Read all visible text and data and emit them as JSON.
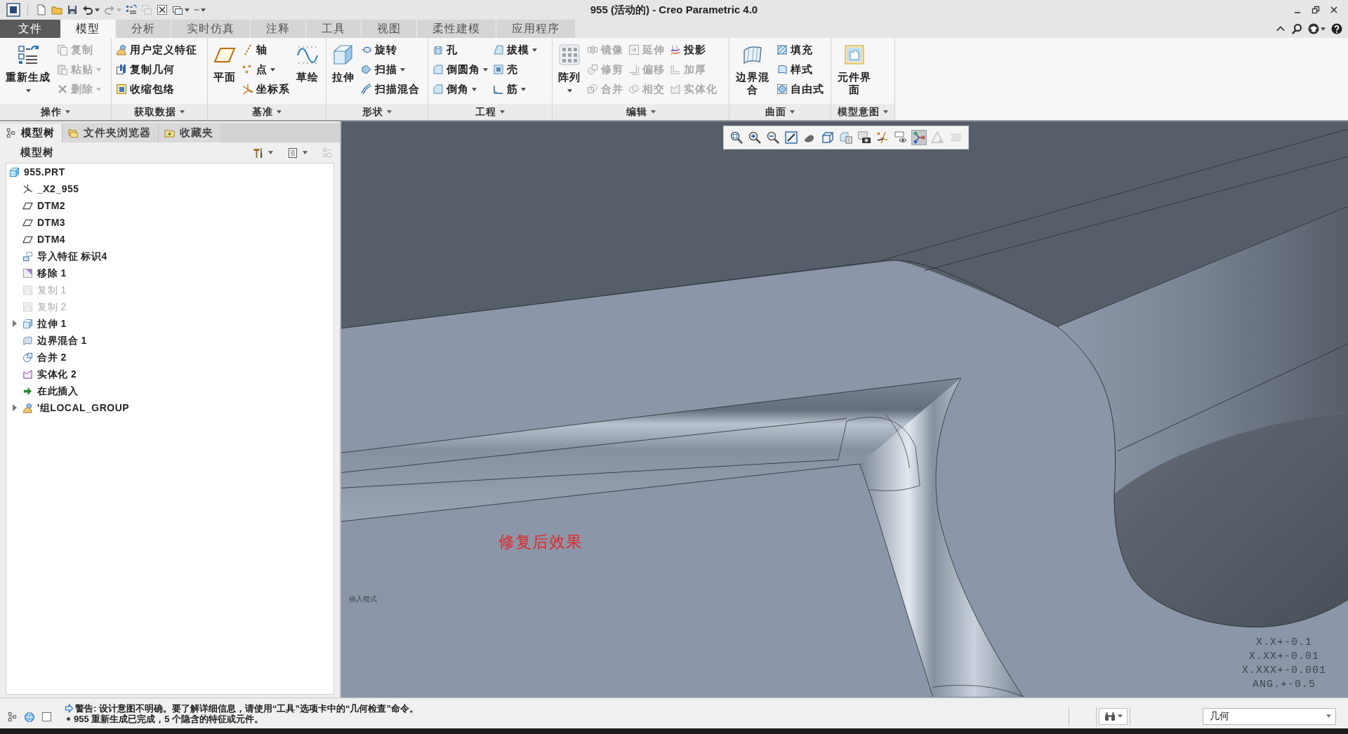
{
  "window": {
    "title": "955 (活动的) - Creo Parametric 4.0"
  },
  "quick_access": [
    {
      "disabled": false,
      "dropdown": false
    },
    {
      "disabled": false,
      "dropdown": false
    },
    {
      "disabled": false,
      "dropdown": false
    },
    {
      "disabled": false,
      "dropdown": true
    },
    {
      "disabled": true,
      "dropdown": true
    },
    {
      "disabled": false,
      "dropdown": false
    },
    {
      "disabled": true,
      "dropdown": false
    },
    {
      "disabled": false,
      "dropdown": false
    },
    {
      "disabled": false,
      "dropdown": true
    },
    {
      "disabled": false,
      "dropdown": true
    }
  ],
  "ribbon_tabs": [
    {
      "label": "文件",
      "kind": "menu",
      "selected": false
    },
    {
      "label": "模型",
      "kind": "tab",
      "selected": true
    },
    {
      "label": "分析",
      "kind": "tab",
      "selected": false
    },
    {
      "label": "实时仿真",
      "kind": "tab",
      "selected": false
    },
    {
      "label": "注释",
      "kind": "tab",
      "selected": false
    },
    {
      "label": "工具",
      "kind": "tab",
      "selected": false
    },
    {
      "label": "视图",
      "kind": "tab",
      "selected": false
    },
    {
      "label": "柔性建模",
      "kind": "tab",
      "selected": false
    },
    {
      "label": "应用程序",
      "kind": "tab",
      "selected": false
    }
  ],
  "ribbon": {
    "groups": [
      {
        "label": "操作",
        "dropdown": true,
        "columns": [
          [
            {
              "kind": "large",
              "label": "重新生成",
              "dropdown": true,
              "disabled": false
            }
          ],
          [
            {
              "kind": "small",
              "label": "复制",
              "dropdown": false,
              "disabled": true
            },
            {
              "kind": "small",
              "label": "粘贴",
              "dropdown": true,
              "disabled": true
            },
            {
              "kind": "small",
              "label": "删除",
              "dropdown": true,
              "disabled": true
            }
          ]
        ]
      },
      {
        "label": "获取数据",
        "dropdown": true,
        "columns": [
          [
            {
              "kind": "small",
              "label": "用户定义特征",
              "dropdown": false,
              "disabled": false
            },
            {
              "kind": "small",
              "label": "复制几何",
              "dropdown": false,
              "disabled": false
            },
            {
              "kind": "small",
              "label": "收缩包络",
              "dropdown": false,
              "disabled": false
            }
          ]
        ]
      },
      {
        "label": "基准",
        "dropdown": true,
        "columns": [
          [
            {
              "kind": "large",
              "label": "平面",
              "dropdown": false,
              "disabled": false
            }
          ],
          [
            {
              "kind": "small",
              "label": "轴",
              "dropdown": false,
              "disabled": false
            },
            {
              "kind": "small",
              "label": "点",
              "dropdown": true,
              "disabled": false
            },
            {
              "kind": "small",
              "label": "坐标系",
              "dropdown": false,
              "disabled": false
            }
          ],
          [
            {
              "kind": "large",
              "label": "草绘",
              "dropdown": false,
              "disabled": false
            }
          ]
        ]
      },
      {
        "label": "形状",
        "dropdown": true,
        "columns": [
          [
            {
              "kind": "large",
              "label": "拉伸",
              "dropdown": false,
              "disabled": false
            }
          ],
          [
            {
              "kind": "small",
              "label": "旋转",
              "dropdown": false,
              "disabled": false
            },
            {
              "kind": "small",
              "label": "扫描",
              "dropdown": true,
              "disabled": false
            },
            {
              "kind": "small",
              "label": "扫描混合",
              "dropdown": false,
              "disabled": false
            }
          ]
        ]
      },
      {
        "label": "工程",
        "dropdown": true,
        "columns": [
          [
            {
              "kind": "small",
              "label": "孔",
              "dropdown": false,
              "disabled": false
            },
            {
              "kind": "small",
              "label": "倒圆角",
              "dropdown": true,
              "disabled": false
            },
            {
              "kind": "small",
              "label": "倒角",
              "dropdown": true,
              "disabled": false
            }
          ],
          [
            {
              "kind": "small",
              "label": "拔模",
              "dropdown": true,
              "disabled": false
            },
            {
              "kind": "small",
              "label": "壳",
              "dropdown": false,
              "disabled": false
            },
            {
              "kind": "small",
              "label": "筋",
              "dropdown": true,
              "disabled": false
            }
          ]
        ]
      },
      {
        "label": "编辑",
        "dropdown": true,
        "columns": [
          [
            {
              "kind": "large",
              "label": "阵列",
              "dropdown": true,
              "disabled": false
            }
          ],
          [
            {
              "kind": "small",
              "label": "镜像",
              "dropdown": false,
              "disabled": true
            },
            {
              "kind": "small",
              "label": "修剪",
              "dropdown": false,
              "disabled": true
            },
            {
              "kind": "small",
              "label": "合并",
              "dropdown": false,
              "disabled": true
            }
          ],
          [
            {
              "kind": "small",
              "label": "延伸",
              "dropdown": false,
              "disabled": true
            },
            {
              "kind": "small",
              "label": "偏移",
              "dropdown": false,
              "disabled": true
            },
            {
              "kind": "small",
              "label": "相交",
              "dropdown": false,
              "disabled": true
            }
          ],
          [
            {
              "kind": "small",
              "label": "投影",
              "dropdown": false,
              "disabled": false
            },
            {
              "kind": "small",
              "label": "加厚",
              "dropdown": false,
              "disabled": true
            },
            {
              "kind": "small",
              "label": "实体化",
              "dropdown": false,
              "disabled": true
            }
          ]
        ]
      },
      {
        "label": "曲面",
        "dropdown": true,
        "columns": [
          [
            {
              "kind": "large",
              "label": "边界混合",
              "dropdown": false,
              "disabled": false
            }
          ],
          [
            {
              "kind": "small",
              "label": "填充",
              "dropdown": false,
              "disabled": false
            },
            {
              "kind": "small",
              "label": "样式",
              "dropdown": false,
              "disabled": false
            },
            {
              "kind": "small",
              "label": "自由式",
              "dropdown": false,
              "disabled": false
            }
          ]
        ]
      },
      {
        "label": "模型意图",
        "dropdown": true,
        "columns": [
          [
            {
              "kind": "large",
              "label": "元件界面",
              "dropdown": false,
              "disabled": false
            }
          ]
        ]
      }
    ]
  },
  "model_tree": {
    "tabs": [
      {
        "label": "模型树",
        "selected": true
      },
      {
        "label": "文件夹浏览器",
        "selected": false
      },
      {
        "label": "收藏夹",
        "selected": false
      }
    ],
    "title": "模型树",
    "items": [
      {
        "label": "955.PRT",
        "kind": "part",
        "dimmed": false,
        "collapsed": false,
        "children": [
          {
            "label": "_X2_955",
            "kind": "csys",
            "dimmed": false,
            "collapsed": false
          },
          {
            "label": "DTM2",
            "kind": "datum_plane",
            "dimmed": false,
            "collapsed": false
          },
          {
            "label": "DTM3",
            "kind": "datum_plane",
            "dimmed": false,
            "collapsed": false
          },
          {
            "label": "DTM4",
            "kind": "datum_plane",
            "dimmed": false,
            "collapsed": false
          },
          {
            "label": "导入特征 标识4",
            "kind": "import",
            "dimmed": false,
            "collapsed": false
          },
          {
            "label": "移除 1",
            "kind": "remove",
            "dimmed": false,
            "collapsed": false
          },
          {
            "label": "复制 1",
            "kind": "copy",
            "dimmed": true,
            "collapsed": false
          },
          {
            "label": "复制 2",
            "kind": "copy",
            "dimmed": true,
            "collapsed": false
          },
          {
            "label": "拉伸 1",
            "kind": "extrude",
            "dimmed": false,
            "collapsed": true
          },
          {
            "label": "边界混合 1",
            "kind": "boundary_blend",
            "dimmed": false,
            "collapsed": false
          },
          {
            "label": "合并 2",
            "kind": "merge",
            "dimmed": false,
            "collapsed": false
          },
          {
            "label": "实体化 2",
            "kind": "solidify",
            "dimmed": false,
            "collapsed": false
          },
          {
            "label": "在此插入",
            "kind": "insert",
            "dimmed": false,
            "collapsed": false
          },
          {
            "label": "'组LOCAL_GROUP",
            "kind": "group",
            "dimmed": false,
            "collapsed": true
          }
        ]
      }
    ]
  },
  "viewport": {
    "view_toolbar": [
      {
        "pressed": false,
        "disabled": false
      },
      {
        "pressed": false,
        "disabled": false
      },
      {
        "pressed": false,
        "disabled": false
      },
      {
        "pressed": false,
        "disabled": false
      },
      {
        "pressed": false,
        "disabled": false
      },
      {
        "pressed": false,
        "disabled": false
      },
      {
        "pressed": false,
        "disabled": false
      },
      {
        "pressed": false,
        "disabled": false
      },
      {
        "pressed": false,
        "disabled": false
      },
      {
        "pressed": false,
        "disabled": false
      },
      {
        "pressed": true,
        "disabled": false
      },
      {
        "pressed": false,
        "disabled": true
      },
      {
        "pressed": false,
        "disabled": true
      }
    ],
    "annotation": "修复后效果",
    "mode_label": "插入模式",
    "tolerances": [
      "X.X+-0.1",
      "X.XX+-0.01",
      "X.XXX+-0.001",
      "ANG.+-0.5"
    ]
  },
  "status_bar": {
    "messages": [
      {
        "kind": "warning",
        "text": "警告: 设计意图不明确。要了解详细信息，请使用“工具”选项卡中的“几何检查”命令。"
      },
      {
        "kind": "info",
        "text": "955 重新生成已完成，5 个隐含的特征或元件。"
      }
    ],
    "selection_filter": "几何"
  }
}
